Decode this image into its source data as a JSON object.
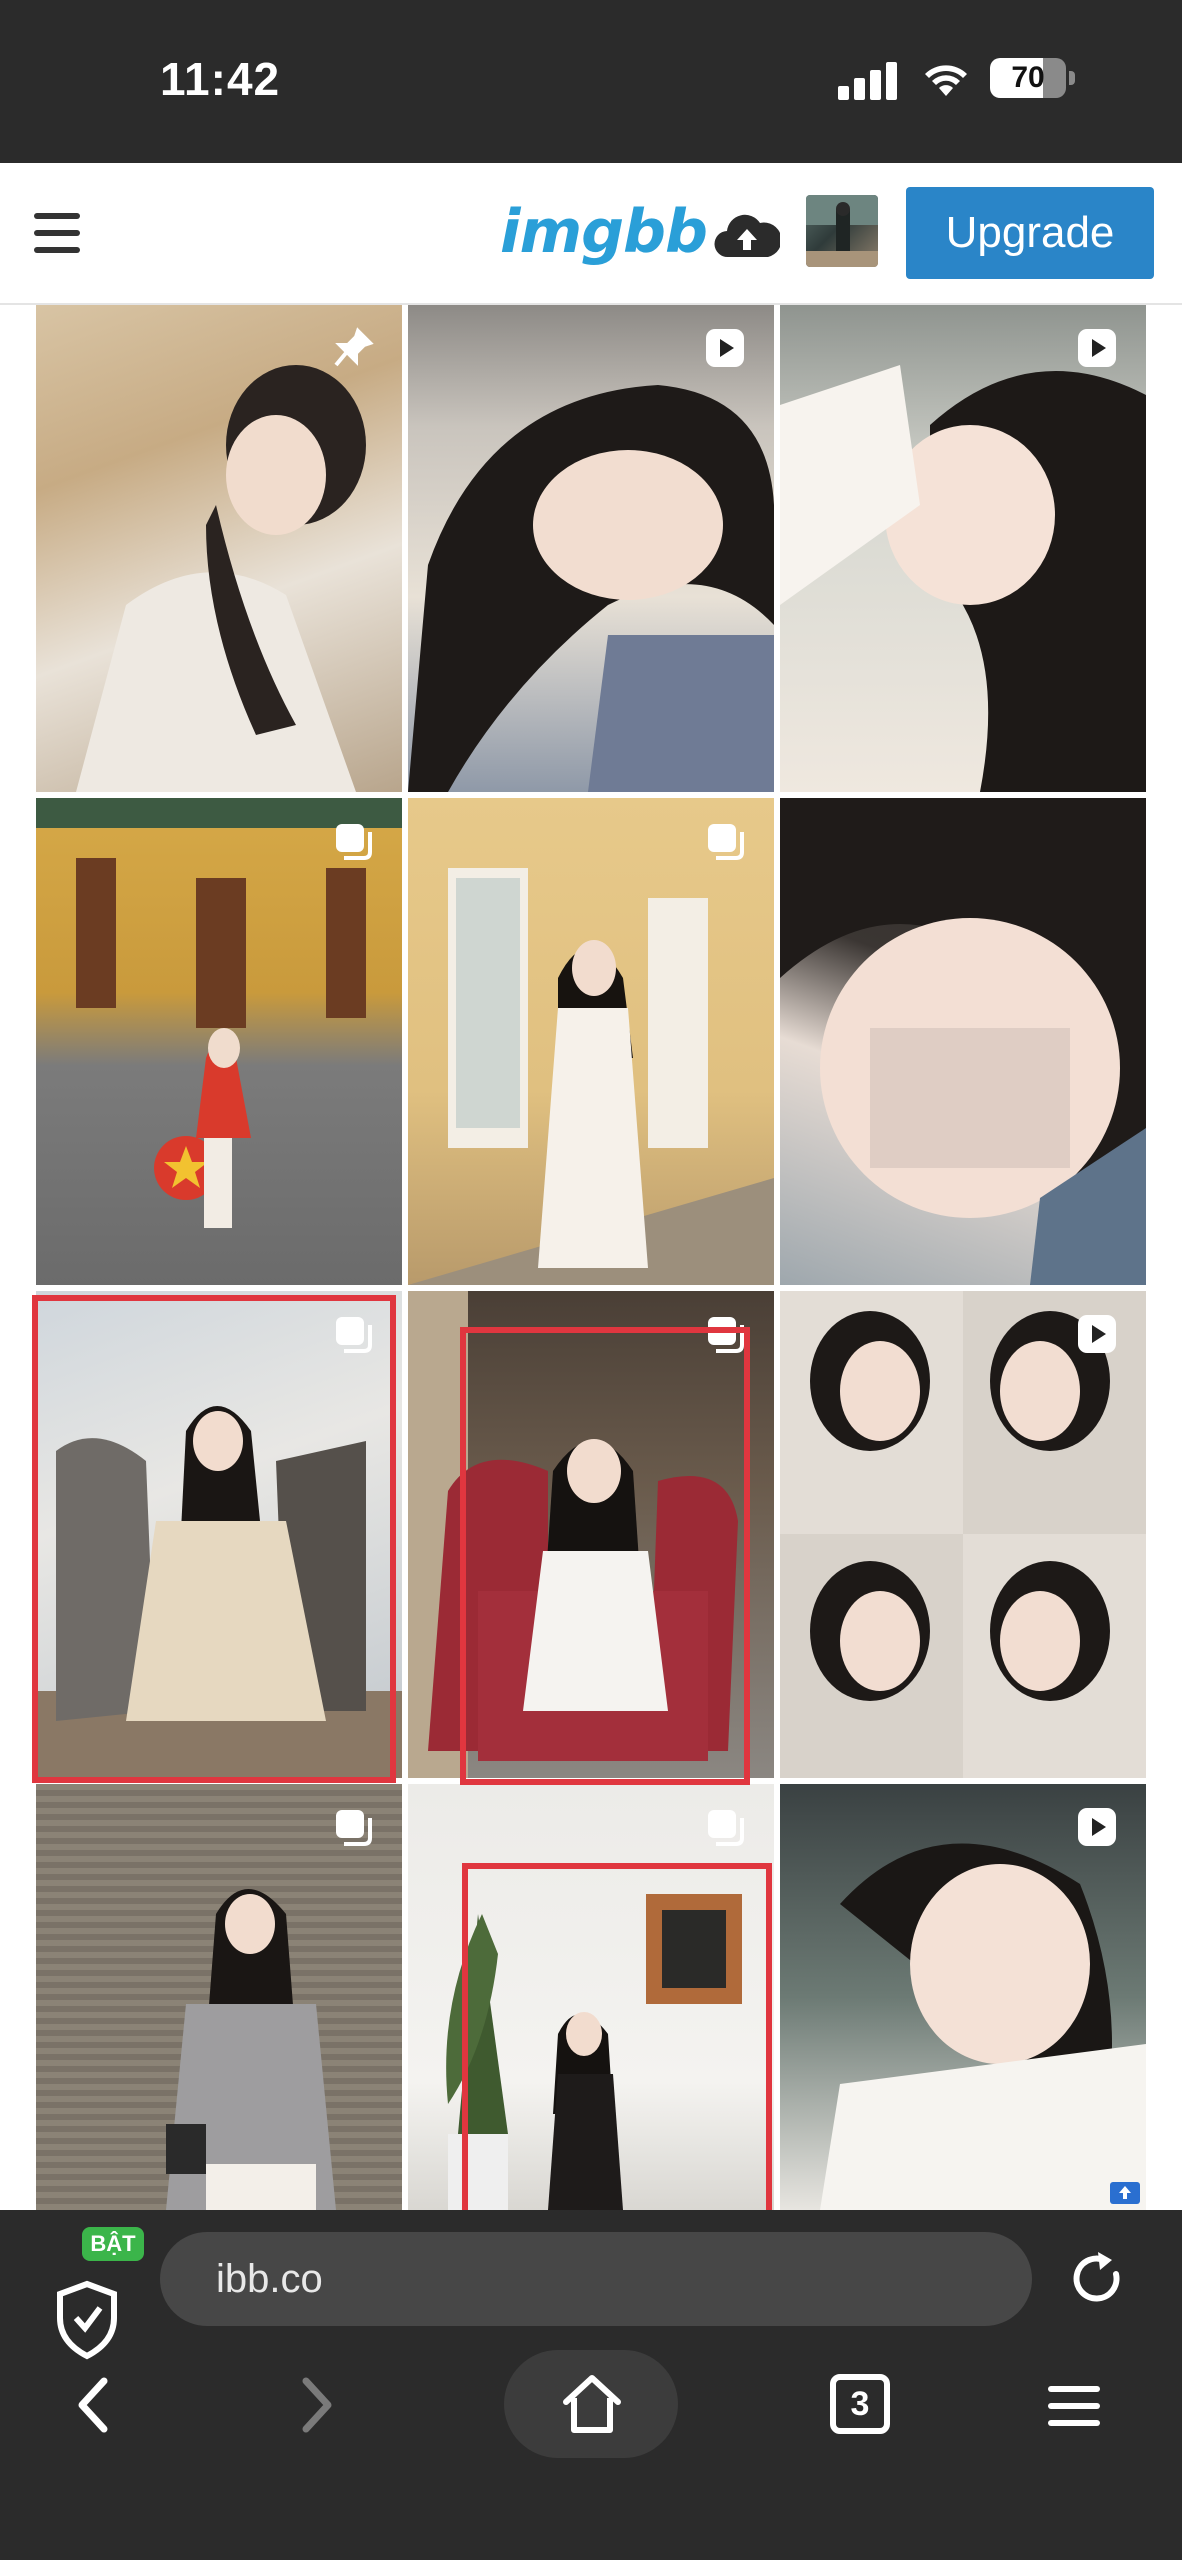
{
  "status_bar": {
    "time": "11:42",
    "battery_level": "70",
    "battery_fraction": 0.7,
    "icons": [
      "signal-icon",
      "wifi-icon",
      "battery-icon"
    ]
  },
  "header": {
    "menu_icon": "hamburger-icon",
    "logo": "imgbb",
    "upload_icon": "cloud-upload-icon",
    "upgrade_label": "Upgrade"
  },
  "gallery": {
    "tiles": [
      {
        "badge": "pin-icon"
      },
      {
        "badge": "video-play-icon"
      },
      {
        "badge": "video-play-icon"
      },
      {
        "badge": "multiple-images-icon"
      },
      {
        "badge": "multiple-images-icon"
      },
      {
        "badge": "none"
      },
      {
        "badge": "multiple-images-icon"
      },
      {
        "badge": "multiple-images-icon"
      },
      {
        "badge": "video-play-icon"
      },
      {
        "badge": "multiple-images-icon"
      },
      {
        "badge": "multiple-images-icon"
      },
      {
        "badge": "video-play-icon"
      }
    ]
  },
  "browser": {
    "shield_badge": "BẬT",
    "url": "ibb.co",
    "tab_count": "3",
    "icons": [
      "shield-icon",
      "reload-icon",
      "back-icon",
      "forward-icon",
      "home-icon",
      "tabs-icon",
      "menu-icon"
    ]
  },
  "colors": {
    "logo_blue": "#2a9fd8",
    "upgrade_blue": "#2a85c8",
    "highlight_red": "#e0363f",
    "bar_dark": "#2b2b2b",
    "badge_green": "#3bb54a"
  }
}
